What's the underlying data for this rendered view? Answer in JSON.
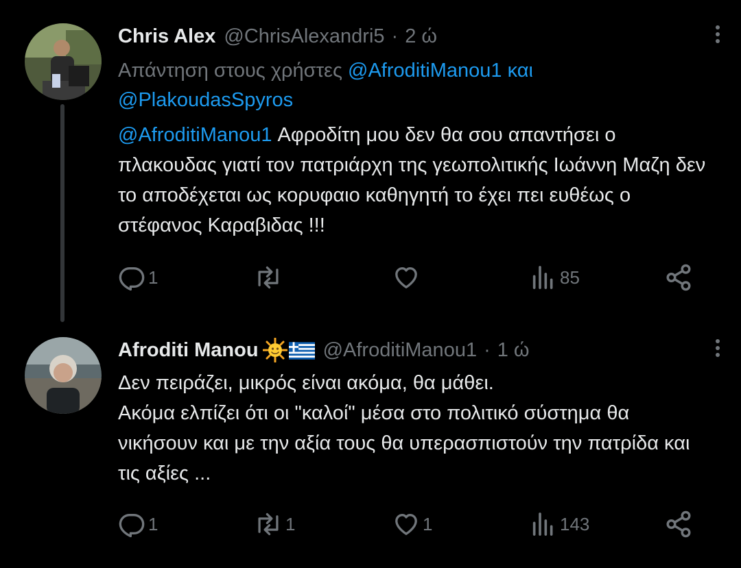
{
  "tweets": [
    {
      "display_name": "Chris Alex",
      "handle": "@ChrisAlexandri5",
      "separator": "·",
      "time": "2 ώ",
      "reply_prefix": "Απάντηση στους χρήστες ",
      "reply_mention_1": "@AfroditiManou1",
      "reply_joiner": " και",
      "reply_mention_2": "@PlakoudasSpyros",
      "text_mention": "@AfroditiManou1",
      "text": " Αφροδίτη μου δεν θα σου απαντήσει ο πλακουδας γιατί τον πατριάρχη της γεωπολιτικής Ιωάννη Μαζη δεν το αποδέχεται ως κορυφαιο καθηγητή το έχει πει ευθέως ο στέφανος Καραβιδας !!!",
      "stats": {
        "replies": "1",
        "reposts": "",
        "likes": "",
        "views": "85"
      }
    },
    {
      "display_name": "Afroditi Manou",
      "name_emojis": [
        "sun-face-emoji",
        "greek-flag-emoji"
      ],
      "handle": "@AfroditiManou1",
      "separator": "·",
      "time": "1 ώ",
      "text": "Δεν πειράζει, μικρός είναι ακόμα, θα μάθει.\nΑκόμα ελπίζει ότι οι \"καλοί\" μέσα στο πολιτικό σύστημα θα νικήσουν και με την αξία τους θα υπερασπιστούν την πατρίδα και τις αξίες ...",
      "stats": {
        "replies": "1",
        "reposts": "1",
        "likes": "1",
        "views": "143"
      }
    }
  ],
  "colors": {
    "background": "#000000",
    "text_primary": "#e7e9ea",
    "text_secondary": "#71767b",
    "link": "#1d9bf0",
    "thread_line": "#333639"
  },
  "icons": [
    "reply-icon",
    "repost-icon",
    "like-icon",
    "views-icon",
    "share-icon",
    "more-options-icon"
  ]
}
